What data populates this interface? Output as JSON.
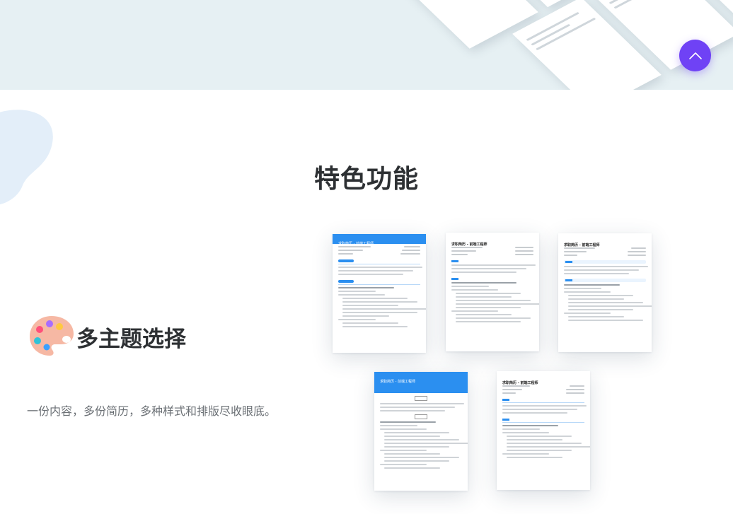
{
  "colors": {
    "accent_purple": "#6f42f5",
    "resume_blue": "#2b8ff0",
    "hero_bg": "#e6f0f3",
    "title_text": "#2d3033",
    "desc_text": "#6b7075"
  },
  "scroll_top_button": {
    "icon": "chevron-up-icon"
  },
  "section": {
    "title": "特色功能"
  },
  "feature": {
    "icon": "palette-icon",
    "heading": "多主题选择",
    "description": "一份内容，多份简历，多种样式和排版尽收眼底。"
  },
  "themes": [
    {
      "header_text": "求职简历 - 前端工程师"
    },
    {
      "header_text": "求职简历 - 前端工程师"
    },
    {
      "header_text": "求职简历 - 前端工程师"
    },
    {
      "header_text": "求职简历 - 前端工程师"
    },
    {
      "header_text": "求职简历 - 前端工程师"
    }
  ]
}
